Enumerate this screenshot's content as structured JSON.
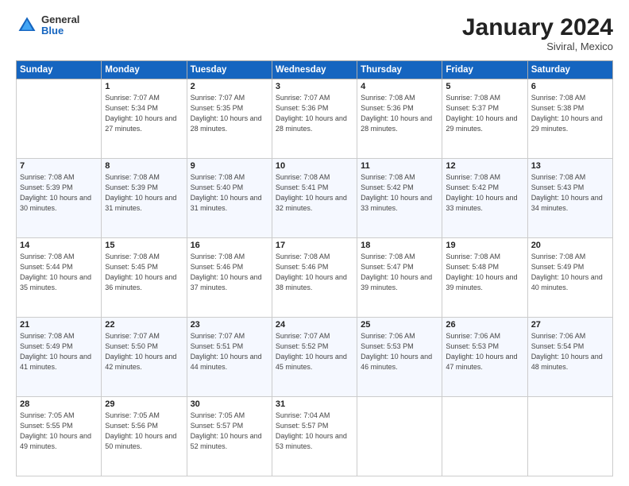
{
  "header": {
    "logo": {
      "general": "General",
      "blue": "Blue"
    },
    "title": "January 2024",
    "location": "Siviral, Mexico"
  },
  "columns": [
    "Sunday",
    "Monday",
    "Tuesday",
    "Wednesday",
    "Thursday",
    "Friday",
    "Saturday"
  ],
  "weeks": [
    [
      {
        "day": "",
        "empty": true
      },
      {
        "day": "1",
        "sunrise": "Sunrise: 7:07 AM",
        "sunset": "Sunset: 5:34 PM",
        "daylight": "Daylight: 10 hours and 27 minutes."
      },
      {
        "day": "2",
        "sunrise": "Sunrise: 7:07 AM",
        "sunset": "Sunset: 5:35 PM",
        "daylight": "Daylight: 10 hours and 28 minutes."
      },
      {
        "day": "3",
        "sunrise": "Sunrise: 7:07 AM",
        "sunset": "Sunset: 5:36 PM",
        "daylight": "Daylight: 10 hours and 28 minutes."
      },
      {
        "day": "4",
        "sunrise": "Sunrise: 7:08 AM",
        "sunset": "Sunset: 5:36 PM",
        "daylight": "Daylight: 10 hours and 28 minutes."
      },
      {
        "day": "5",
        "sunrise": "Sunrise: 7:08 AM",
        "sunset": "Sunset: 5:37 PM",
        "daylight": "Daylight: 10 hours and 29 minutes."
      },
      {
        "day": "6",
        "sunrise": "Sunrise: 7:08 AM",
        "sunset": "Sunset: 5:38 PM",
        "daylight": "Daylight: 10 hours and 29 minutes."
      }
    ],
    [
      {
        "day": "7",
        "sunrise": "Sunrise: 7:08 AM",
        "sunset": "Sunset: 5:39 PM",
        "daylight": "Daylight: 10 hours and 30 minutes."
      },
      {
        "day": "8",
        "sunrise": "Sunrise: 7:08 AM",
        "sunset": "Sunset: 5:39 PM",
        "daylight": "Daylight: 10 hours and 31 minutes."
      },
      {
        "day": "9",
        "sunrise": "Sunrise: 7:08 AM",
        "sunset": "Sunset: 5:40 PM",
        "daylight": "Daylight: 10 hours and 31 minutes."
      },
      {
        "day": "10",
        "sunrise": "Sunrise: 7:08 AM",
        "sunset": "Sunset: 5:41 PM",
        "daylight": "Daylight: 10 hours and 32 minutes."
      },
      {
        "day": "11",
        "sunrise": "Sunrise: 7:08 AM",
        "sunset": "Sunset: 5:42 PM",
        "daylight": "Daylight: 10 hours and 33 minutes."
      },
      {
        "day": "12",
        "sunrise": "Sunrise: 7:08 AM",
        "sunset": "Sunset: 5:42 PM",
        "daylight": "Daylight: 10 hours and 33 minutes."
      },
      {
        "day": "13",
        "sunrise": "Sunrise: 7:08 AM",
        "sunset": "Sunset: 5:43 PM",
        "daylight": "Daylight: 10 hours and 34 minutes."
      }
    ],
    [
      {
        "day": "14",
        "sunrise": "Sunrise: 7:08 AM",
        "sunset": "Sunset: 5:44 PM",
        "daylight": "Daylight: 10 hours and 35 minutes."
      },
      {
        "day": "15",
        "sunrise": "Sunrise: 7:08 AM",
        "sunset": "Sunset: 5:45 PM",
        "daylight": "Daylight: 10 hours and 36 minutes."
      },
      {
        "day": "16",
        "sunrise": "Sunrise: 7:08 AM",
        "sunset": "Sunset: 5:46 PM",
        "daylight": "Daylight: 10 hours and 37 minutes."
      },
      {
        "day": "17",
        "sunrise": "Sunrise: 7:08 AM",
        "sunset": "Sunset: 5:46 PM",
        "daylight": "Daylight: 10 hours and 38 minutes."
      },
      {
        "day": "18",
        "sunrise": "Sunrise: 7:08 AM",
        "sunset": "Sunset: 5:47 PM",
        "daylight": "Daylight: 10 hours and 39 minutes."
      },
      {
        "day": "19",
        "sunrise": "Sunrise: 7:08 AM",
        "sunset": "Sunset: 5:48 PM",
        "daylight": "Daylight: 10 hours and 39 minutes."
      },
      {
        "day": "20",
        "sunrise": "Sunrise: 7:08 AM",
        "sunset": "Sunset: 5:49 PM",
        "daylight": "Daylight: 10 hours and 40 minutes."
      }
    ],
    [
      {
        "day": "21",
        "sunrise": "Sunrise: 7:08 AM",
        "sunset": "Sunset: 5:49 PM",
        "daylight": "Daylight: 10 hours and 41 minutes."
      },
      {
        "day": "22",
        "sunrise": "Sunrise: 7:07 AM",
        "sunset": "Sunset: 5:50 PM",
        "daylight": "Daylight: 10 hours and 42 minutes."
      },
      {
        "day": "23",
        "sunrise": "Sunrise: 7:07 AM",
        "sunset": "Sunset: 5:51 PM",
        "daylight": "Daylight: 10 hours and 44 minutes."
      },
      {
        "day": "24",
        "sunrise": "Sunrise: 7:07 AM",
        "sunset": "Sunset: 5:52 PM",
        "daylight": "Daylight: 10 hours and 45 minutes."
      },
      {
        "day": "25",
        "sunrise": "Sunrise: 7:06 AM",
        "sunset": "Sunset: 5:53 PM",
        "daylight": "Daylight: 10 hours and 46 minutes."
      },
      {
        "day": "26",
        "sunrise": "Sunrise: 7:06 AM",
        "sunset": "Sunset: 5:53 PM",
        "daylight": "Daylight: 10 hours and 47 minutes."
      },
      {
        "day": "27",
        "sunrise": "Sunrise: 7:06 AM",
        "sunset": "Sunset: 5:54 PM",
        "daylight": "Daylight: 10 hours and 48 minutes."
      }
    ],
    [
      {
        "day": "28",
        "sunrise": "Sunrise: 7:05 AM",
        "sunset": "Sunset: 5:55 PM",
        "daylight": "Daylight: 10 hours and 49 minutes."
      },
      {
        "day": "29",
        "sunrise": "Sunrise: 7:05 AM",
        "sunset": "Sunset: 5:56 PM",
        "daylight": "Daylight: 10 hours and 50 minutes."
      },
      {
        "day": "30",
        "sunrise": "Sunrise: 7:05 AM",
        "sunset": "Sunset: 5:57 PM",
        "daylight": "Daylight: 10 hours and 52 minutes."
      },
      {
        "day": "31",
        "sunrise": "Sunrise: 7:04 AM",
        "sunset": "Sunset: 5:57 PM",
        "daylight": "Daylight: 10 hours and 53 minutes."
      },
      {
        "day": "",
        "empty": true
      },
      {
        "day": "",
        "empty": true
      },
      {
        "day": "",
        "empty": true
      }
    ]
  ]
}
